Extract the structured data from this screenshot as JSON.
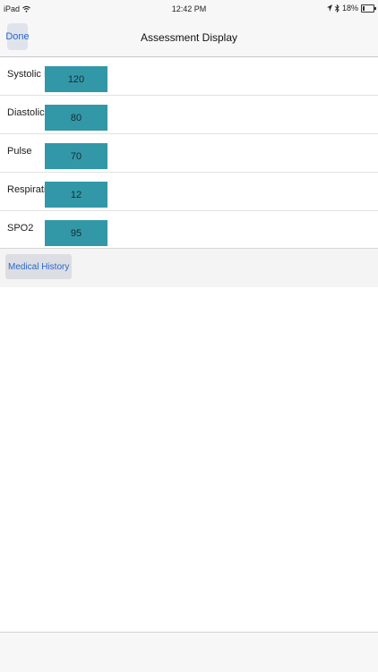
{
  "status_bar": {
    "device": "iPad",
    "time": "12:42 PM",
    "battery": "18%",
    "battery_level": 0.18,
    "icons": [
      "wifi-icon",
      "location-icon",
      "bluetooth-icon",
      "battery-icon"
    ]
  },
  "nav": {
    "done_label": "Done",
    "title": "Assessment Display"
  },
  "rows": [
    {
      "label": "Systolic BP",
      "value": "120"
    },
    {
      "label": "Diastolic BP",
      "value": "80"
    },
    {
      "label": "Pulse",
      "value": "70"
    },
    {
      "label": "Respiration",
      "value": "12"
    },
    {
      "label": "SPO2",
      "value": "95"
    }
  ],
  "footer": {
    "medical_history_label": "Medical History"
  },
  "colors": {
    "accent": "#2a67c9",
    "value_fill": "#3298a8"
  }
}
